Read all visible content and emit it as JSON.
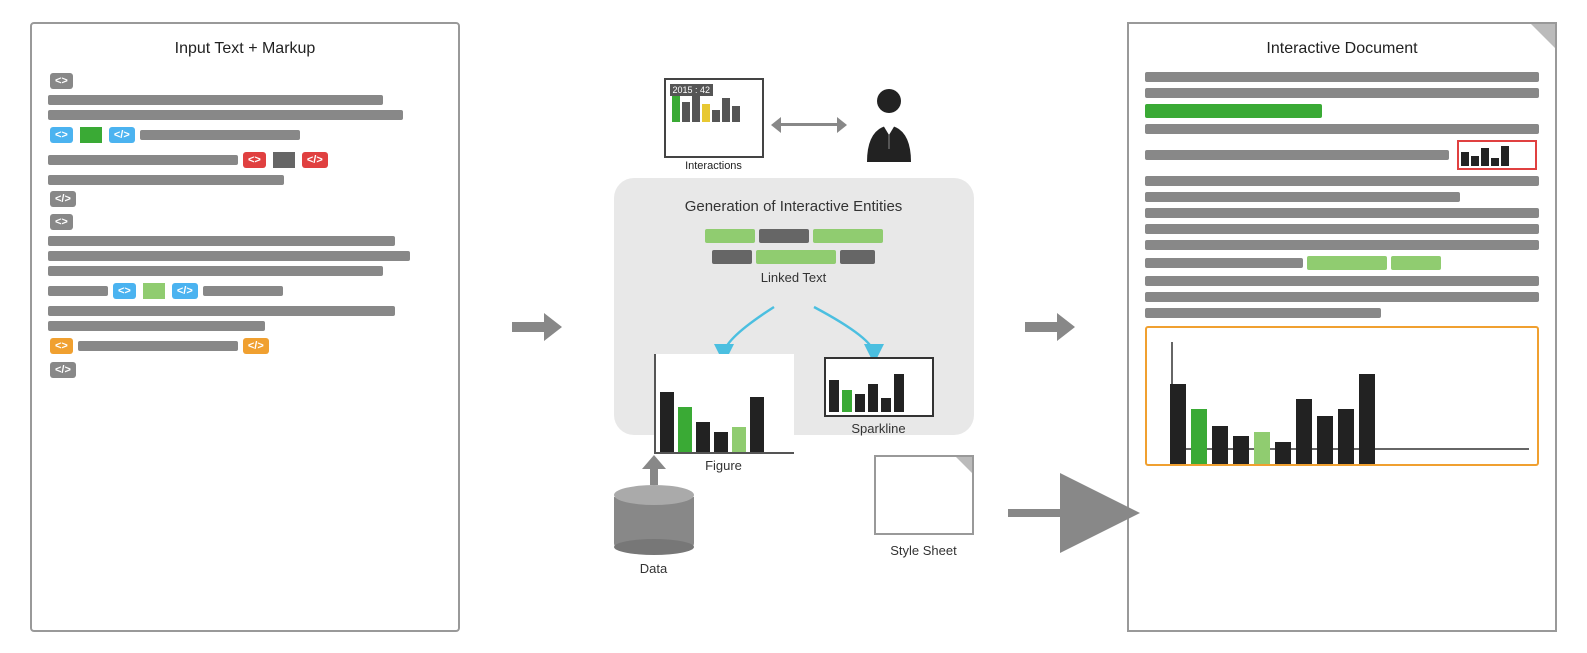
{
  "left_panel": {
    "title": "Input Text + Markup",
    "lines": [
      {
        "type": "tag_gray",
        "label": "<>"
      },
      {
        "type": "text_line",
        "width": "85%"
      },
      {
        "type": "text_line",
        "width": "90%"
      },
      {
        "type": "markup_row",
        "items": [
          "tag_blue_open",
          "block_green",
          "tag_blue_close",
          "text_75"
        ]
      },
      {
        "type": "markup_row",
        "items": [
          "text_50",
          "tag_red_open",
          "block_gray",
          "tag_red_close"
        ]
      },
      {
        "type": "text_line",
        "width": "60%"
      },
      {
        "type": "tag_gray",
        "label": "</>"
      },
      {
        "type": "tag_gray2",
        "label": "<>"
      },
      {
        "type": "text_line",
        "width": "88%"
      },
      {
        "type": "text_line",
        "width": "92%"
      },
      {
        "type": "text_line",
        "width": "85%"
      },
      {
        "type": "markup_row",
        "items": [
          "text_30",
          "tag_blue_open",
          "block_lightgreen",
          "tag_blue_close",
          "text_40"
        ]
      },
      {
        "type": "text_line",
        "width": "88%"
      },
      {
        "type": "text_line",
        "width": "55%"
      },
      {
        "type": "markup_row_orange",
        "items": [
          "tag_orange_open",
          "text_45",
          "tag_orange_close"
        ]
      },
      {
        "type": "tag_gray3",
        "label": "</>"
      }
    ]
  },
  "middle": {
    "interactions_label": "Interactions",
    "interactions_year": "2015 : 42",
    "gen_title": "Generation of Interactive Entities",
    "linked_text_label": "Linked Text",
    "figure_label": "Figure",
    "sparkline_label": "Sparkline",
    "data_label": "Data",
    "stylesheet_label": "Style Sheet"
  },
  "right_panel": {
    "title": "Interactive Document"
  },
  "arrows": {
    "left_to_mid": "→",
    "mid_to_right": "→",
    "ss_to_doc": "→"
  }
}
